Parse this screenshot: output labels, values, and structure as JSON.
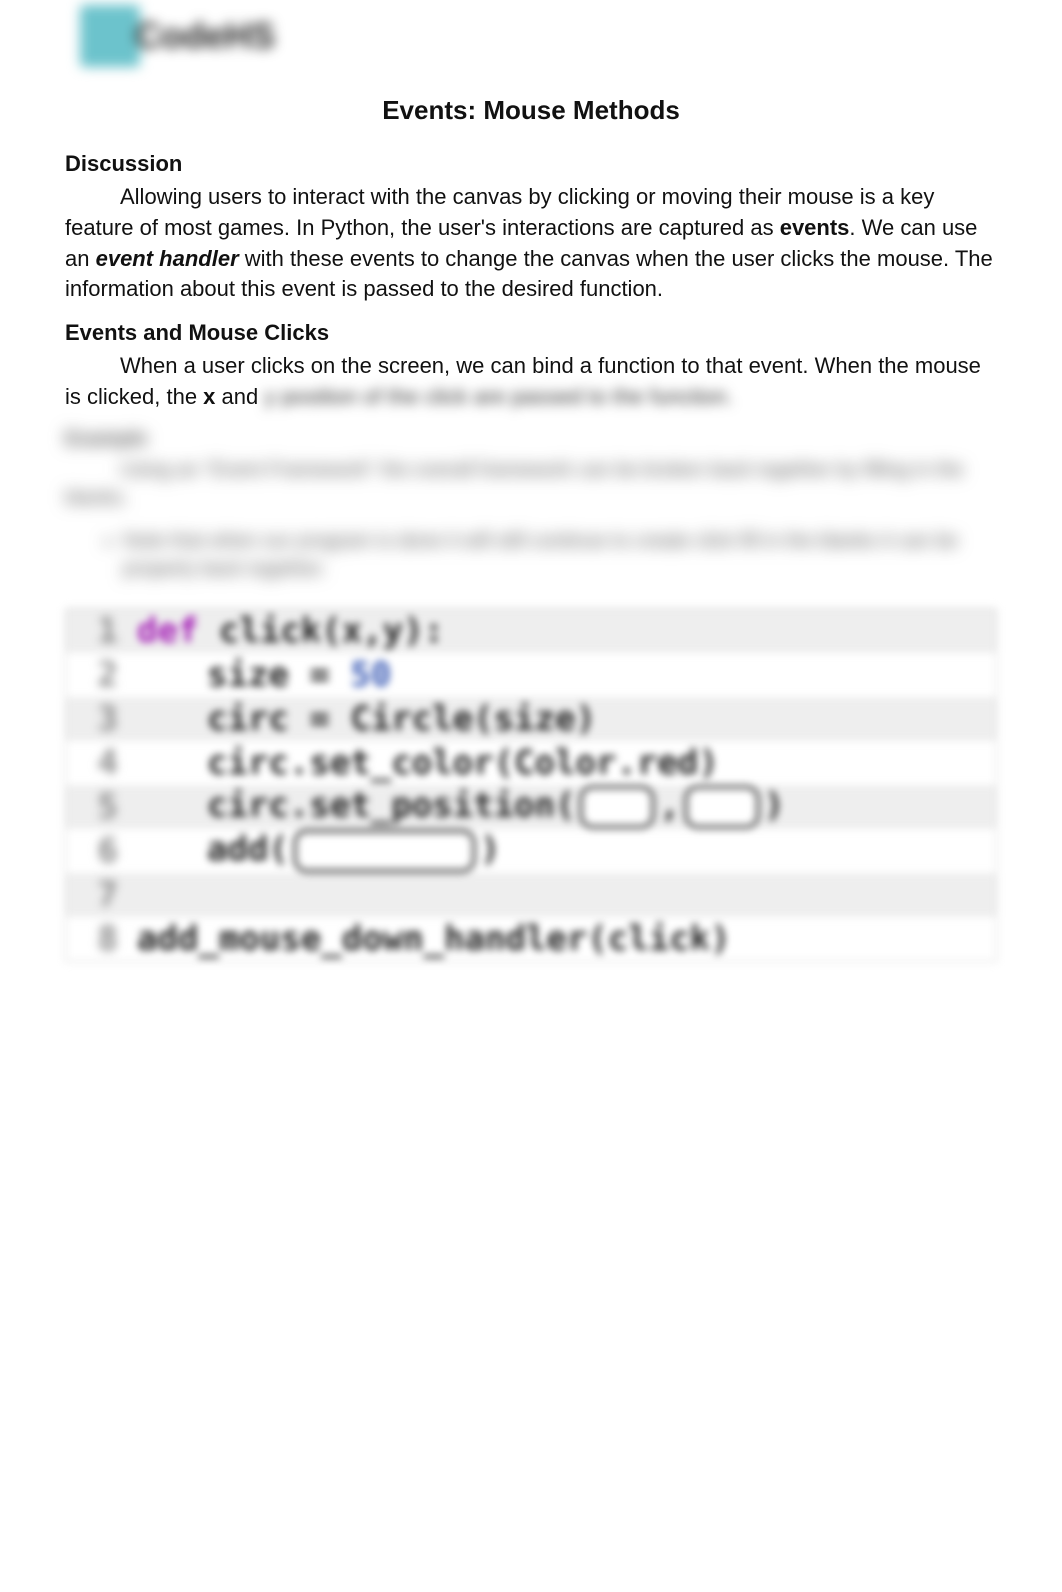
{
  "logo": {
    "text": "CodeHS"
  },
  "title": "Events: Mouse Methods",
  "discussion": {
    "heading": "Discussion",
    "p1_a": "Allowing users to interact with the canvas by clicking or moving their mouse is a key feature of most games. In Python, the user's interactions are captured as ",
    "p1_b_events": "events",
    "p1_c": ". We can use an ",
    "p1_d_handler": "event handler",
    "p1_e": " with these events to change the canvas when the user clicks the mouse. The information about this event is passed to the desired function."
  },
  "clicks": {
    "heading": "Events and Mouse Clicks",
    "p1_a": "When a user clicks on the screen, we can bind a function to that event. When the mouse is clicked, the ",
    "p1_b_x": "x",
    "p1_c": " and ",
    "p1_d_blurred": "y position of the click are passed to the function."
  },
  "example": {
    "heading": "Example",
    "intro": "Using an \"Event Framework\" the overall framework can be broken back together by filling in the blanks.",
    "bullet": "Note that when our program is done it will still continue to create click fill in the blanks it can be properly back together."
  },
  "code": {
    "lines": [
      {
        "n": "1",
        "raw": "def click(x,y):"
      },
      {
        "n": "2",
        "raw": "    size = 50"
      },
      {
        "n": "3",
        "raw": "    circ = Circle(size)"
      },
      {
        "n": "4",
        "raw": "    circ.set_color(Color.red)"
      },
      {
        "n": "5",
        "raw": "    circ.set_position(  ,  )"
      },
      {
        "n": "6",
        "raw": "    add(          )"
      },
      {
        "n": "7",
        "raw": ""
      },
      {
        "n": "8",
        "raw": "add_mouse_down_handler(click)"
      }
    ]
  }
}
